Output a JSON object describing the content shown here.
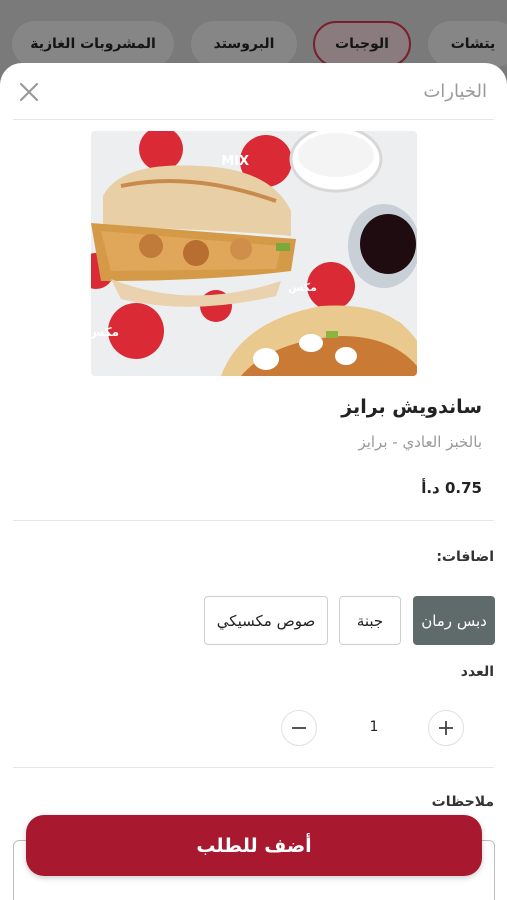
{
  "categories": [
    {
      "label": "يتشات",
      "active": false
    },
    {
      "label": "الوجبات",
      "active": true
    },
    {
      "label": "البروستد",
      "active": false
    },
    {
      "label": "المشروبات الغازية",
      "active": false
    }
  ],
  "sheet": {
    "title": "الخيارات",
    "close_icon": "close-icon"
  },
  "item": {
    "name": "ساندويش برايز",
    "description": "بالخبز العادي - برايز",
    "price": "0.75 د.أ",
    "photo_brand": "MIX",
    "photo_brand_ar": "مكس"
  },
  "addons": {
    "label": "اضافات:",
    "options": [
      {
        "label": "دبس رمان",
        "selected": true
      },
      {
        "label": "جبنة",
        "selected": false
      },
      {
        "label": "صوص مكسيكي",
        "selected": false
      }
    ]
  },
  "quantity": {
    "label": "العدد",
    "value": "1"
  },
  "notes": {
    "label": "ملاحظات"
  },
  "cta": {
    "label": "أضف للطلب"
  },
  "colors": {
    "accent": "#a8182f",
    "selected_addon": "#5f6b6a"
  }
}
